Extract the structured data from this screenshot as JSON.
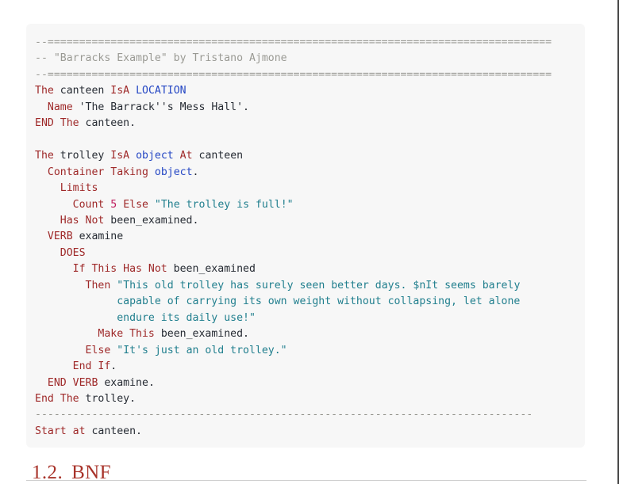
{
  "page": {
    "title_number": "1.2.",
    "title_text": "BNF"
  },
  "code_block": {
    "language": "alan",
    "colors": {
      "background": "#f7f7f7",
      "comment": "#9a9a94",
      "keyword": "#9e2828",
      "type": "#2547c4",
      "string": "#217f8e",
      "number": "#c02060",
      "identifier": "#262b33",
      "rule": "#8f8f88"
    },
    "lines": [
      {
        "tokens": [
          {
            "t": "--===============================================================",
            "c": "comment"
          },
          {
            "t": "=================",
            "c": "comment"
          }
        ]
      },
      {
        "tokens": [
          {
            "t": "-- \"Barracks Example\" by Tristano Ajmone",
            "c": "comment"
          }
        ]
      },
      {
        "tokens": [
          {
            "t": "--===============================================================",
            "c": "comment"
          },
          {
            "t": "=================",
            "c": "comment"
          }
        ]
      },
      {
        "tokens": [
          {
            "t": "The",
            "c": "keyword"
          },
          {
            "t": " canteen ",
            "c": "identifier"
          },
          {
            "t": "IsA",
            "c": "keyword"
          },
          {
            "t": " ",
            "c": "identifier"
          },
          {
            "t": "LOCATION",
            "c": "type"
          }
        ]
      },
      {
        "tokens": [
          {
            "t": "  ",
            "c": "identifier"
          },
          {
            "t": "Name",
            "c": "keyword"
          },
          {
            "t": " 'The Barrack''s Mess Hall'.",
            "c": "identifier"
          }
        ]
      },
      {
        "tokens": [
          {
            "t": "END The",
            "c": "keyword"
          },
          {
            "t": " canteen.",
            "c": "identifier"
          }
        ]
      },
      {
        "tokens": []
      },
      {
        "tokens": [
          {
            "t": "The",
            "c": "keyword"
          },
          {
            "t": " trolley ",
            "c": "identifier"
          },
          {
            "t": "IsA",
            "c": "keyword"
          },
          {
            "t": " ",
            "c": "identifier"
          },
          {
            "t": "object",
            "c": "type"
          },
          {
            "t": " ",
            "c": "identifier"
          },
          {
            "t": "At",
            "c": "keyword"
          },
          {
            "t": " canteen",
            "c": "identifier"
          }
        ]
      },
      {
        "tokens": [
          {
            "t": "  ",
            "c": "identifier"
          },
          {
            "t": "Container Taking",
            "c": "keyword"
          },
          {
            "t": " ",
            "c": "identifier"
          },
          {
            "t": "object",
            "c": "type"
          },
          {
            "t": ".",
            "c": "identifier"
          }
        ]
      },
      {
        "tokens": [
          {
            "t": "    ",
            "c": "identifier"
          },
          {
            "t": "Limits",
            "c": "keyword"
          }
        ]
      },
      {
        "tokens": [
          {
            "t": "      ",
            "c": "identifier"
          },
          {
            "t": "Count",
            "c": "keyword"
          },
          {
            "t": " ",
            "c": "identifier"
          },
          {
            "t": "5",
            "c": "number"
          },
          {
            "t": " ",
            "c": "identifier"
          },
          {
            "t": "Else",
            "c": "keyword"
          },
          {
            "t": " ",
            "c": "identifier"
          },
          {
            "t": "\"The trolley is full!\"",
            "c": "string"
          }
        ]
      },
      {
        "tokens": [
          {
            "t": "    ",
            "c": "identifier"
          },
          {
            "t": "Has Not",
            "c": "keyword"
          },
          {
            "t": " been_examined.",
            "c": "identifier"
          }
        ]
      },
      {
        "tokens": [
          {
            "t": "  ",
            "c": "identifier"
          },
          {
            "t": "VERB",
            "c": "keyword"
          },
          {
            "t": " examine",
            "c": "identifier"
          }
        ]
      },
      {
        "tokens": [
          {
            "t": "    ",
            "c": "identifier"
          },
          {
            "t": "DOES",
            "c": "keyword"
          }
        ]
      },
      {
        "tokens": [
          {
            "t": "      ",
            "c": "identifier"
          },
          {
            "t": "If This Has Not",
            "c": "keyword"
          },
          {
            "t": " been_examined",
            "c": "identifier"
          }
        ]
      },
      {
        "tokens": [
          {
            "t": "        ",
            "c": "identifier"
          },
          {
            "t": "Then",
            "c": "keyword"
          },
          {
            "t": " ",
            "c": "identifier"
          },
          {
            "t": "\"This old trolley has surely seen better days. $nIt seems barely",
            "c": "string"
          }
        ]
      },
      {
        "tokens": [
          {
            "t": "             ",
            "c": "identifier"
          },
          {
            "t": "capable of carrying its own weight without collapsing, let alone",
            "c": "string"
          }
        ]
      },
      {
        "tokens": [
          {
            "t": "             ",
            "c": "identifier"
          },
          {
            "t": "endure its daily use!\"",
            "c": "string"
          }
        ]
      },
      {
        "tokens": [
          {
            "t": "          ",
            "c": "identifier"
          },
          {
            "t": "Make This",
            "c": "keyword"
          },
          {
            "t": " been_examined.",
            "c": "identifier"
          }
        ]
      },
      {
        "tokens": [
          {
            "t": "        ",
            "c": "identifier"
          },
          {
            "t": "Else",
            "c": "keyword"
          },
          {
            "t": " ",
            "c": "identifier"
          },
          {
            "t": "\"It's just an old trolley.\"",
            "c": "string"
          }
        ]
      },
      {
        "tokens": [
          {
            "t": "      ",
            "c": "identifier"
          },
          {
            "t": "End If",
            "c": "keyword"
          },
          {
            "t": ".",
            "c": "identifier"
          }
        ]
      },
      {
        "tokens": [
          {
            "t": "  ",
            "c": "identifier"
          },
          {
            "t": "END VERB",
            "c": "keyword"
          },
          {
            "t": " examine.",
            "c": "identifier"
          }
        ]
      },
      {
        "tokens": [
          {
            "t": "End The",
            "c": "keyword"
          },
          {
            "t": " trolley.",
            "c": "identifier"
          }
        ]
      },
      {
        "tokens": [
          {
            "t": "----------------------------------------------------------------",
            "c": "rule"
          },
          {
            "t": "---------------",
            "c": "rule"
          }
        ]
      },
      {
        "tokens": [
          {
            "t": "Start at",
            "c": "keyword"
          },
          {
            "t": " canteen.",
            "c": "identifier"
          }
        ]
      }
    ]
  }
}
